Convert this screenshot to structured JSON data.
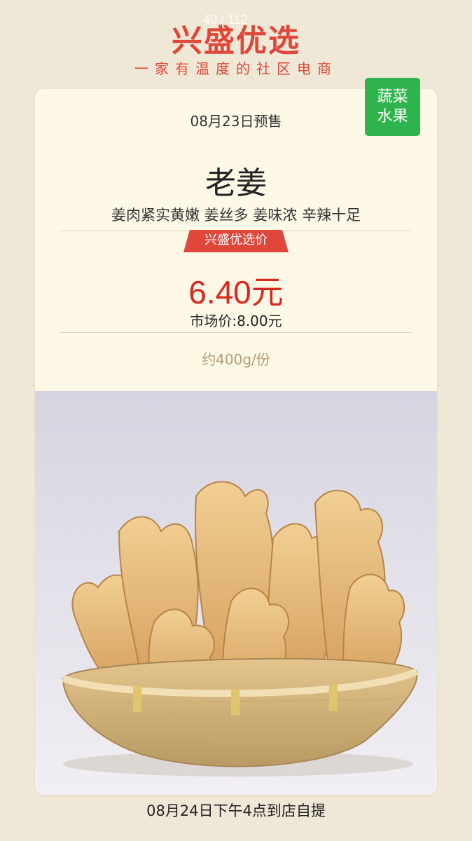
{
  "header": {
    "brand_title": "兴盛优选",
    "slogan": "一家有温度的社区电商",
    "page_counter": "40 / 112"
  },
  "card": {
    "category": {
      "line1": "蔬菜",
      "line2": "水果",
      "color": "#2fb34c"
    },
    "presale": "08月23日预售",
    "product_name": "老姜",
    "description": "姜肉紧实黄嫩 姜丝多 姜味浓 辛辣十足",
    "price_label": "兴盛优选价",
    "price": "6.40元",
    "market_price": "市场价:8.00元",
    "weight": "约400g/份",
    "image_icon": "ginger-basket-photo"
  },
  "footer": {
    "pickup": "08月24日下午4点到店自提"
  },
  "colors": {
    "accent": "#e1463a",
    "price": "#d9271d",
    "background": "#efe8d6",
    "card": "#fdf9e6"
  }
}
